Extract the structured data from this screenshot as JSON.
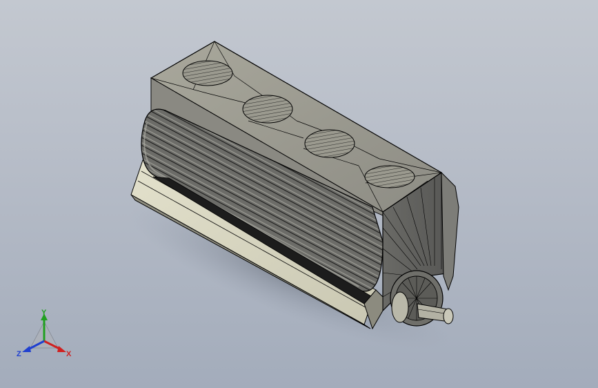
{
  "viewport": {
    "background_top": "#c3c8d0",
    "background_bottom": "#a3acbb"
  },
  "model": {
    "name": "",
    "body_color": "#6e6e6b",
    "face_light": "#d9d8c6",
    "face_mid": "#9a9a90",
    "face_dark": "#4a4a48",
    "edge_color": "#000000"
  },
  "triad": {
    "x_label": "X",
    "y_label": "Y",
    "z_label": "Z",
    "x_color": "#d02020",
    "y_color": "#20a020",
    "z_color": "#2040d0"
  }
}
